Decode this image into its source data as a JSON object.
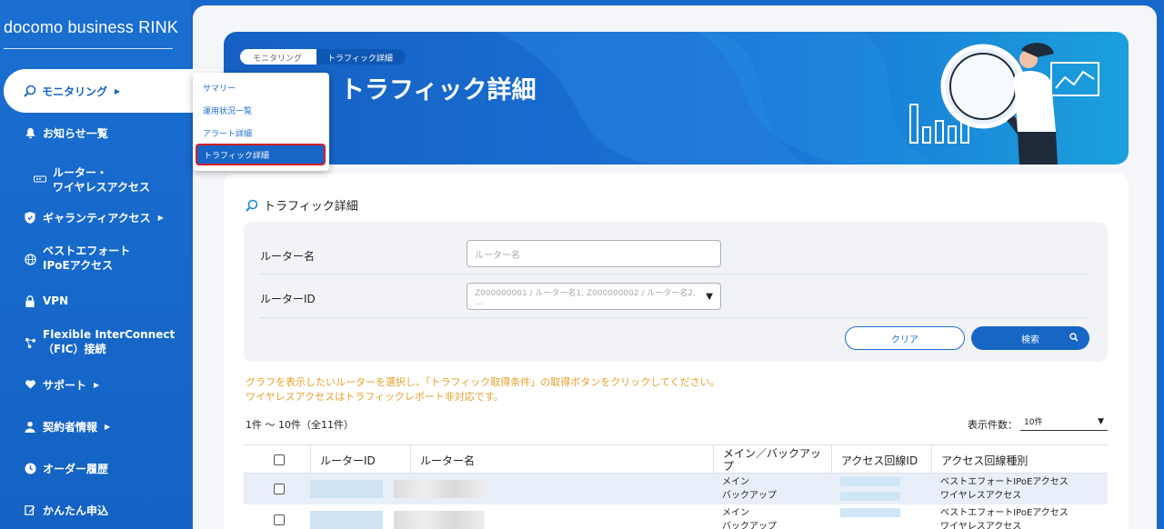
{
  "sidebar": {
    "brand": "docomo business RINK",
    "active": {
      "label": "モニタリング",
      "icon": "monitoring-search-icon"
    },
    "items": [
      {
        "label": "お知らせ一覧",
        "icon": "bell-icon"
      },
      {
        "label": "ルーター・",
        "label2": "ワイヤレスアクセス",
        "icon": "router-icon"
      },
      {
        "label": "ギャランティアクセス",
        "icon": "shield-icon"
      },
      {
        "label": "ベストエフォート",
        "label2": "IPoEアクセス",
        "icon": "globe-icon"
      },
      {
        "label": "VPN",
        "icon": "lock-icon"
      },
      {
        "label": "Flexible InterConnect",
        "label2": "（FIC）接続",
        "icon": "network-icon"
      },
      {
        "label": "サポート",
        "icon": "heart-hand-icon"
      },
      {
        "label": "契約者情報",
        "icon": "user-icon"
      },
      {
        "label": "オーダー履歴",
        "icon": "clock-icon"
      },
      {
        "label": "かんたん申込",
        "icon": "edit-icon"
      }
    ]
  },
  "dropdown": {
    "items": [
      "サマリー",
      "運用状況一覧",
      "アラート詳細"
    ],
    "active": "トラフィック詳細"
  },
  "banner": {
    "breadcrumb": [
      "モニタリング",
      "トラフィック詳細"
    ],
    "title": "トラフィック詳細"
  },
  "card": {
    "title": "トラフィック詳細",
    "filter": {
      "router_name_label": "ルーター名",
      "router_name_placeholder": "ルーター名",
      "router_id_label": "ルーターID",
      "router_id_placeholder": "Z000000001 / ルーター名1, Z000000002 / ルーター名2, ...",
      "clear_label": "クリア",
      "search_label": "検索"
    },
    "notice_line1": "グラフを表示したいルーターを選択し、「トラフィック取得条件」の取得ボタンをクリックしてください。",
    "notice_line2": "ワイヤレスアクセスはトラフィックレポート非対応です。",
    "count": "1件 〜 10件（全11件）",
    "perpage_label": "表示件数：",
    "perpage_value": "10件",
    "table": {
      "headers": [
        "ルーターID",
        "ルーター名",
        "メイン／バックアップ",
        "アクセス回線ID",
        "アクセス回線種別"
      ],
      "rows": [
        {
          "mb": [
            "メイン",
            "バックアップ"
          ],
          "types": [
            "ベストエフォートIPoEアクセス",
            "ワイヤレスアクセス"
          ]
        },
        {
          "mb": [
            "メイン",
            "バックアップ"
          ],
          "types": [
            "ベストエフォートIPoEアクセス",
            "ワイヤレスアクセス"
          ]
        }
      ]
    }
  }
}
